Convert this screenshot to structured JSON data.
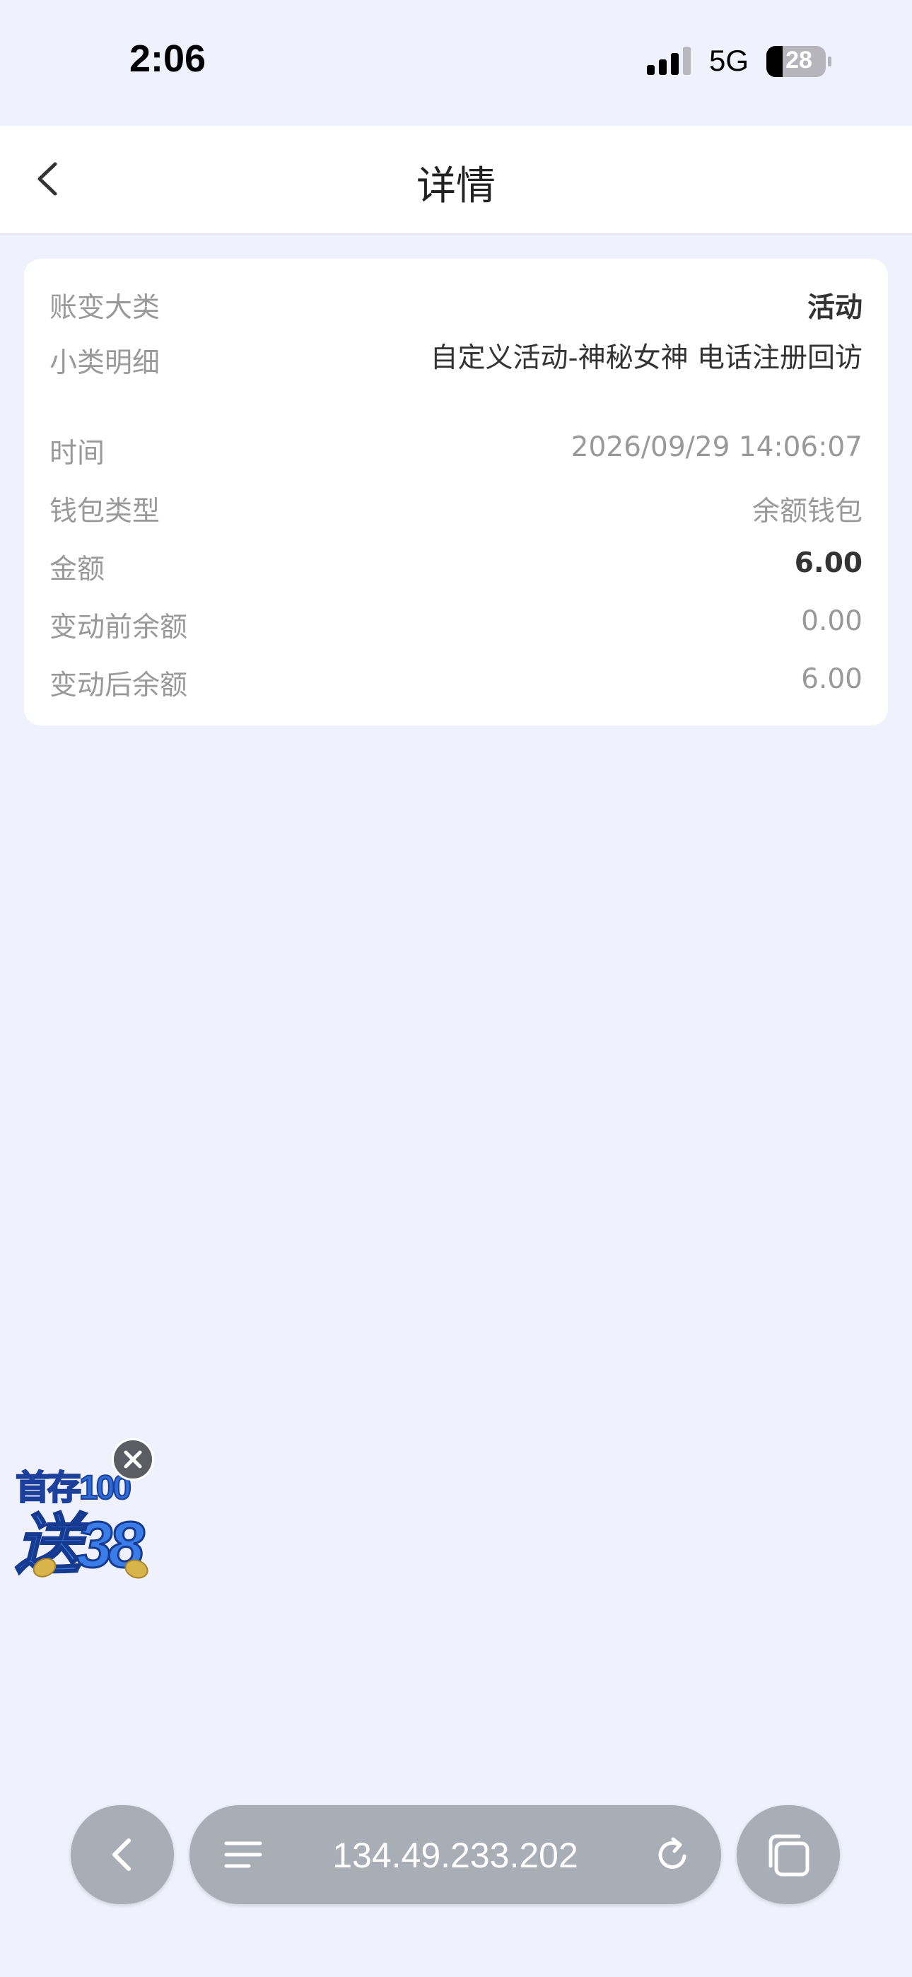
{
  "status_bar": {
    "time": "2:06",
    "network": "5G",
    "battery": "28"
  },
  "header": {
    "title": "详情",
    "back_icon": "chevron-left-icon"
  },
  "details": [
    {
      "label": "账变大类",
      "value": "活动",
      "style": "bold"
    },
    {
      "label": "小类明细",
      "value": "自定义活动-神秘女神 电话注册回访",
      "style": "multi"
    },
    {
      "label": "时间",
      "value": "2026/09/29 14:06:07",
      "style": "muted"
    },
    {
      "label": "钱包类型",
      "value": "余额钱包",
      "style": "muted"
    },
    {
      "label": "金额",
      "value": "6.00",
      "style": "bold"
    },
    {
      "label": "变动前余额",
      "value": "0.00",
      "style": "muted"
    },
    {
      "label": "变动后余额",
      "value": "6.00",
      "style": "muted"
    }
  ],
  "promo": {
    "line1": "首存100",
    "line2": "送38",
    "close_icon": "close-icon"
  },
  "browser_bar": {
    "url": "134.49.233.202",
    "back_icon": "chevron-left-icon",
    "menu_icon": "menu-icon",
    "reload_icon": "reload-icon",
    "tabs_icon": "tabs-icon"
  },
  "colors": {
    "page_bg": "#eff2fc",
    "card_bg": "#ffffff",
    "muted_text": "#999999",
    "dark_text": "#333333",
    "pill_bg": "#a9adb6"
  }
}
